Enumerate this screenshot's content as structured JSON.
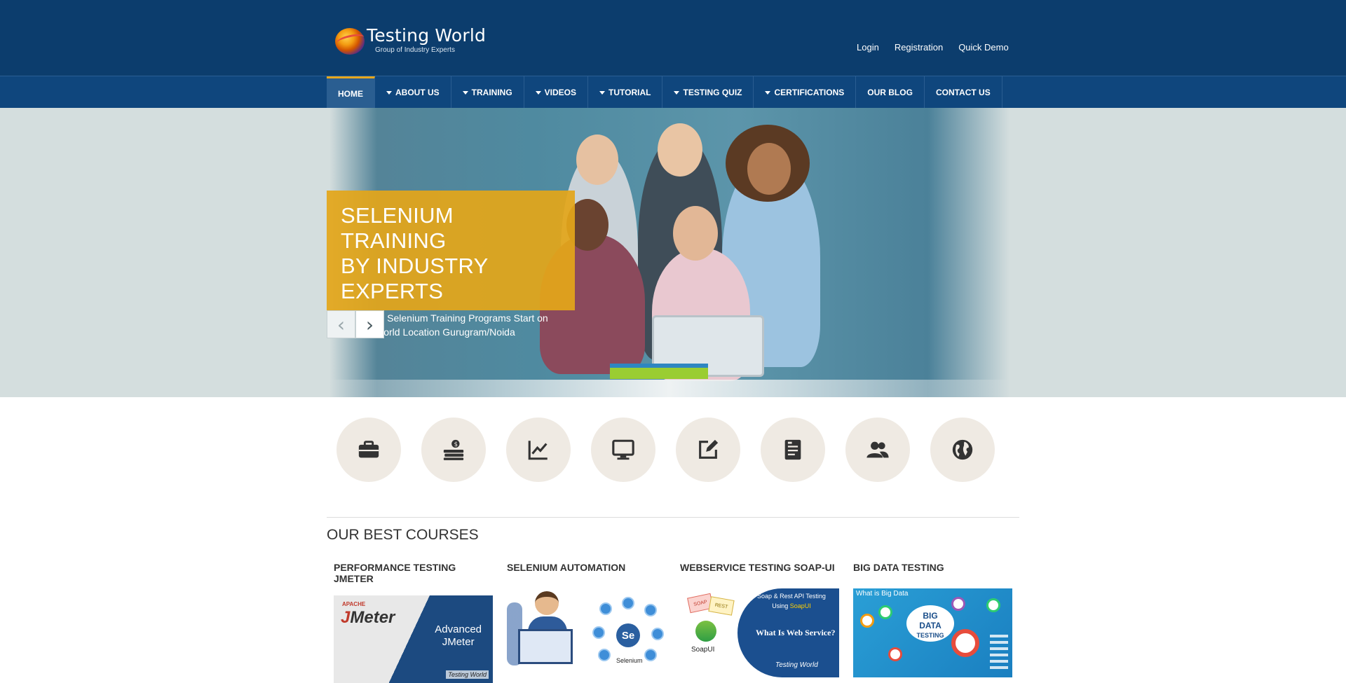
{
  "brand": {
    "name": "Testing World",
    "tagline": "Group of Industry Experts"
  },
  "top_links": [
    "Login",
    "Registration",
    "Quick Demo"
  ],
  "nav": [
    {
      "label": "HOME",
      "dropdown": false,
      "active": true
    },
    {
      "label": "ABOUT US",
      "dropdown": true,
      "active": false
    },
    {
      "label": "TRAINING",
      "dropdown": true,
      "active": false
    },
    {
      "label": "VIDEOS",
      "dropdown": true,
      "active": false
    },
    {
      "label": "TUTORIAL",
      "dropdown": true,
      "active": false
    },
    {
      "label": "TESTING QUIZ",
      "dropdown": true,
      "active": false
    },
    {
      "label": "CERTIFICATIONS",
      "dropdown": true,
      "active": false
    },
    {
      "label": "OUR BLOG",
      "dropdown": false,
      "active": false
    },
    {
      "label": "CONTACT US",
      "dropdown": false,
      "active": false
    }
  ],
  "hero": {
    "title_line1": "SELENIUM TRAINING",
    "title_line2": "BY INDUSTRY EXPERTS",
    "text": "Advanced Selenium Training Programs Start on Testing World Location Gurugram/Noida",
    "prev_icon": "chevron-left-icon",
    "next_icon": "chevron-right-icon"
  },
  "features": [
    {
      "icon": "briefcase-icon"
    },
    {
      "icon": "money-icon"
    },
    {
      "icon": "line-chart-icon"
    },
    {
      "icon": "monitor-icon"
    },
    {
      "icon": "edit-icon"
    },
    {
      "icon": "document-icon"
    },
    {
      "icon": "users-icon"
    },
    {
      "icon": "globe-icon"
    }
  ],
  "section_title": "OUR BEST COURSES",
  "courses": [
    {
      "title": "PERFORMANCE TESTING JMETER",
      "image": {
        "apache": "APACHE",
        "logo_a": "J",
        "logo_b": "Meter",
        "line1": "Advanced",
        "line2": "JMeter",
        "brand": "Testing World"
      }
    },
    {
      "title": "SELENIUM AUTOMATION",
      "image": {
        "hub": "Se",
        "label": "Selenium"
      }
    },
    {
      "title": "WEBSERVICE TESTING SOAP-UI",
      "image": {
        "soap": "SOAP",
        "rest": "REST",
        "heading_a": "Soap & Rest API Testing",
        "heading_b": "Using",
        "heading_c": "SoapUI",
        "question": "What Is Web Service?",
        "label": "SoapUI",
        "brand": "Testing World"
      }
    },
    {
      "title": "BIG DATA TESTING",
      "image": {
        "top": "What is Big Data",
        "line1": "BIG",
        "line2": "DATA",
        "line3": "TESTING"
      }
    }
  ],
  "colors": {
    "header": "#0c3d6d",
    "navbar": "#0f467d",
    "accent": "#e7a71d",
    "caption": "#e3a61a"
  }
}
